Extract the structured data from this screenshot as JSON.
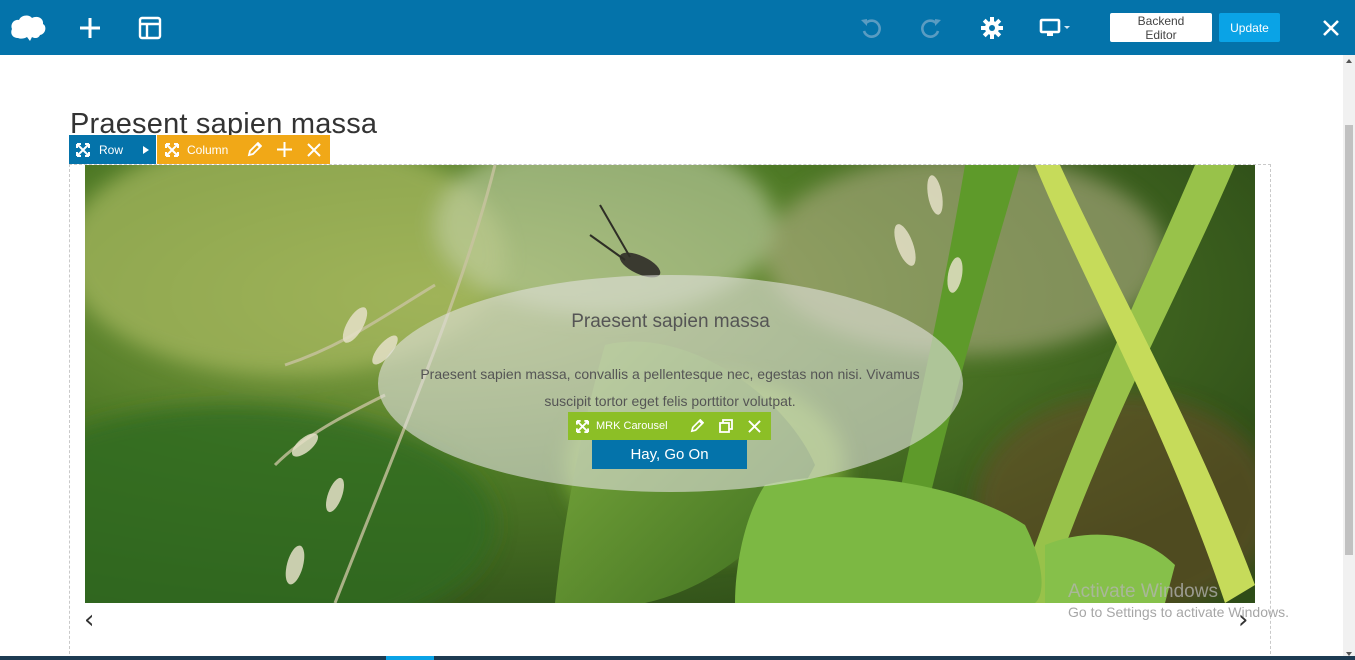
{
  "toolbar": {
    "logo_icon": "cloud-icon",
    "add_icon": "plus-icon",
    "layout_icon": "layout-template-icon",
    "undo_icon": "undo-icon",
    "redo_icon": "redo-icon",
    "settings_icon": "gear-icon",
    "device_icon": "desktop-icon",
    "backend_label": "Backend Editor",
    "update_label": "Update",
    "close_icon": "close-icon",
    "accent_color": "#0473aa"
  },
  "page": {
    "title": "Praesent sapien massa"
  },
  "row_controls": {
    "row_label": "Row",
    "column_label": "Column",
    "row_color": "#0473aa",
    "column_color": "#f1a817"
  },
  "carousel": {
    "slide_title": "Praesent sapien massa",
    "slide_text": "Praesent sapien massa, convallis a pellentesque nec, egestas non nisi. Vivamus suscipit tortor eget felis porttitor volutpat.",
    "button_label": "Hay, Go On",
    "element_label": "MRK Carousel",
    "element_color": "#8cbf26",
    "prev_glyph": "‹",
    "next_glyph": "›"
  },
  "watermark": {
    "line1": "Activate Windows",
    "line2": "Go to Settings to activate Windows."
  }
}
